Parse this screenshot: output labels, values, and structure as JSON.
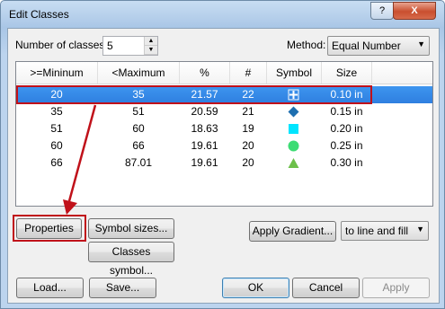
{
  "window": {
    "title": "Edit Classes",
    "help_label": "?",
    "close_label": "X"
  },
  "classes": {
    "label": "Number of classes:",
    "value": "5",
    "up": "▲",
    "down": "▼"
  },
  "method": {
    "label": "Method:",
    "value": "Equal Number",
    "arrow": "▼"
  },
  "table": {
    "headers": [
      ">=Mininum",
      "<Maximum",
      "%",
      "#",
      "Symbol",
      "Size"
    ],
    "rows": [
      {
        "min": "20",
        "max": "35",
        "pct": "21.57",
        "count": "22",
        "symbol": "cross",
        "size": "0.10 in"
      },
      {
        "min": "35",
        "max": "51",
        "pct": "20.59",
        "count": "21",
        "symbol": "diamond",
        "size": "0.15 in"
      },
      {
        "min": "51",
        "max": "60",
        "pct": "18.63",
        "count": "19",
        "symbol": "square",
        "size": "0.20 in"
      },
      {
        "min": "60",
        "max": "66",
        "pct": "19.61",
        "count": "20",
        "symbol": "circle",
        "size": "0.25 in"
      },
      {
        "min": "66",
        "max": "87.01",
        "pct": "19.61",
        "count": "20",
        "symbol": "triangle",
        "size": "0.30 in"
      }
    ],
    "selected_row": 0
  },
  "buttons": {
    "properties": "Properties",
    "symbol_sizes": "Symbol sizes...",
    "classes_symbol": "Classes symbol...",
    "apply_gradient": "Apply Gradient...",
    "load": "Load...",
    "save": "Save...",
    "ok": "OK",
    "cancel": "Cancel",
    "apply": "Apply"
  },
  "gradient_target": {
    "value": "to line and fill",
    "arrow": "▼"
  },
  "colors": {
    "selection": "#3399ff",
    "highlight": "#c0111a",
    "diamond": "#1e6fb0",
    "square": "#00e5ff",
    "circle": "#3ddc74",
    "triangle": "#6dc04b"
  }
}
